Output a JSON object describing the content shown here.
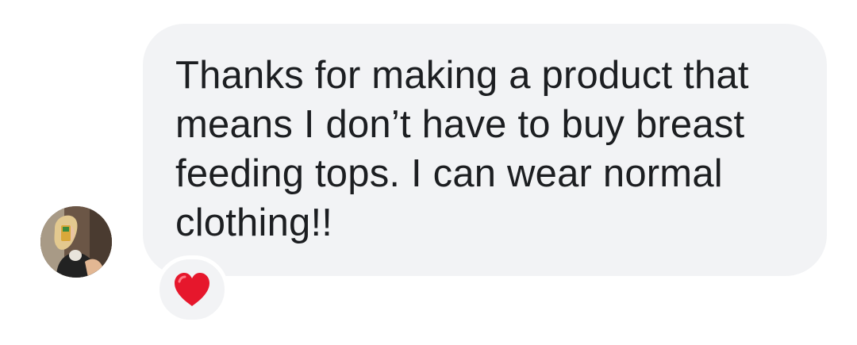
{
  "message": {
    "text": "Thanks for making a product that\nmeans I don’t have to buy breast\nfeeding tops. I can wear normal\nclothing!!"
  },
  "sender": {
    "avatar_icon": "profile-photo"
  },
  "reaction": {
    "icon": "red-heart",
    "color": "#e6172c"
  },
  "colors": {
    "bubble": "#f2f3f5",
    "text": "#1c1e21",
    "background": "#ffffff"
  }
}
